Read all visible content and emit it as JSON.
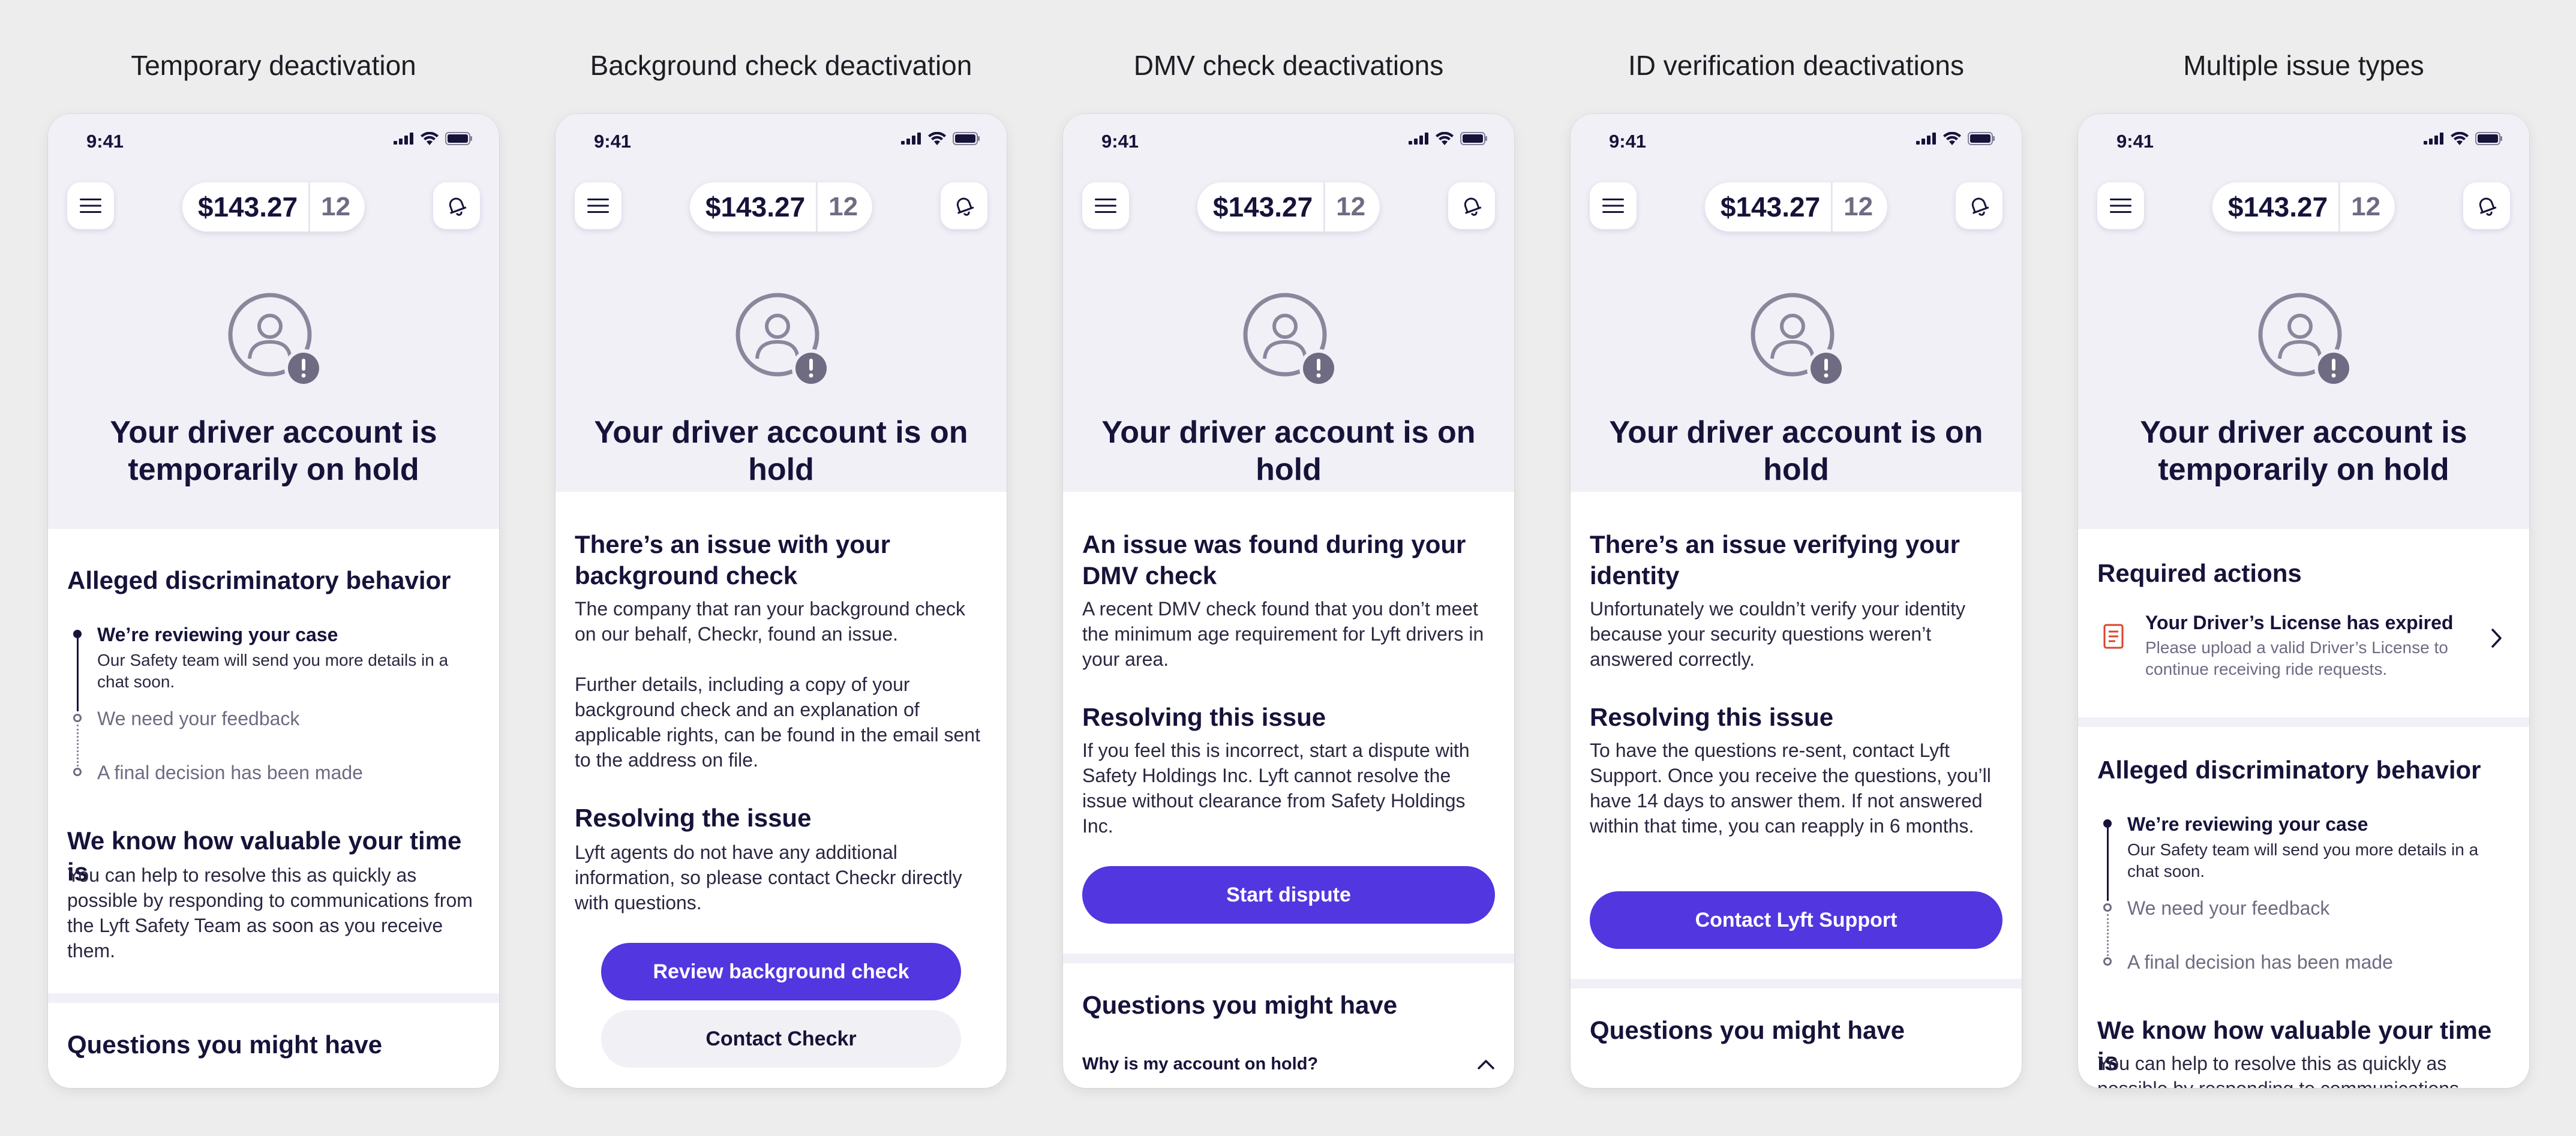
{
  "colors": {
    "accent": "#5236e0",
    "hero_bg": "#f1f0f7",
    "text_primary": "#16133a",
    "text_muted": "#6e6b82",
    "alert": "#d9452b",
    "avatar_outline": "#8a879c"
  },
  "status_bar": {
    "time": "9:41"
  },
  "earnings": {
    "amount": "$143.27",
    "count": "12"
  },
  "columns": [
    {
      "title": "Temporary deactivation",
      "hero_title": "Your driver account is temporarily on hold",
      "issue_title": "Alleged discriminatory behavior",
      "timeline": [
        {
          "title": "We’re reviewing your case",
          "desc": "Our Safety team will send you more details in a chat soon."
        },
        {
          "title": "We need your feedback"
        },
        {
          "title": "A final decision has been made"
        }
      ],
      "time_title": "We know how valuable your time is",
      "time_body": "You can help to resolve this as quickly as possible by responding to communications from the Lyft Safety Team as soon as you receive them.",
      "questions_title": "Questions you might have"
    },
    {
      "title": "Background check deactivation",
      "hero_title": "Your driver account is on hold",
      "issue_title": "There’s an issue with your background check",
      "issue_body": "The company that ran your background check on our behalf, Checkr, found an issue.",
      "issue_body2": "Further details, including a copy of your background check and an explanation of applicable rights, can be found in the email sent to the address on file.",
      "resolve_title": "Resolving the issue",
      "resolve_body": "Lyft agents do not have any additional information, so please contact Checkr directly with questions.",
      "primary_button": "Review background check",
      "secondary_button": "Contact Checkr"
    },
    {
      "title": "DMV check deactivations",
      "hero_title": "Your driver account is on hold",
      "issue_title": "An issue was found during your DMV check",
      "issue_body": "A recent DMV check found that you don’t meet the minimum age requirement for Lyft drivers in your area.",
      "resolve_title": "Resolving this issue",
      "resolve_body": "If you feel this is incorrect, start a dispute with Safety Holdings Inc. Lyft cannot resolve the issue without clearance from Safety Holdings Inc.",
      "primary_button": "Start dispute",
      "questions_title": "Questions you might have",
      "faq": "Why is my account on hold?"
    },
    {
      "title": "ID verification deactivations",
      "hero_title": "Your driver account is on hold",
      "issue_title": "There’s an issue verifying your identity",
      "issue_body": "Unfortunately we couldn’t verify your identity because your security questions weren’t answered correctly.",
      "resolve_title": "Resolving this issue",
      "resolve_body": "To have the questions re-sent, contact Lyft Support. Once you receive the questions, you’ll have 14 days to answer them. If not answered within that time, you can reapply in 6 months.",
      "primary_button": "Contact Lyft Support",
      "questions_title": "Questions you might have"
    },
    {
      "title": "Multiple issue types",
      "hero_title": "Your driver account is temporarily on hold",
      "required_title": "Required actions",
      "action_title": "Your Driver’s License has expired",
      "action_desc": "Please upload a valid Driver’s License to continue receiving ride requests.",
      "issue_title": "Alleged discriminatory behavior",
      "timeline": [
        {
          "title": "We’re reviewing your case",
          "desc": "Our Safety team will send you more details in a chat soon."
        },
        {
          "title": "We need your feedback"
        },
        {
          "title": "A final decision has been made"
        }
      ],
      "time_title": "We know how valuable your time is",
      "time_body": "You can help to resolve this as quickly as possible by responding to communications"
    }
  ]
}
